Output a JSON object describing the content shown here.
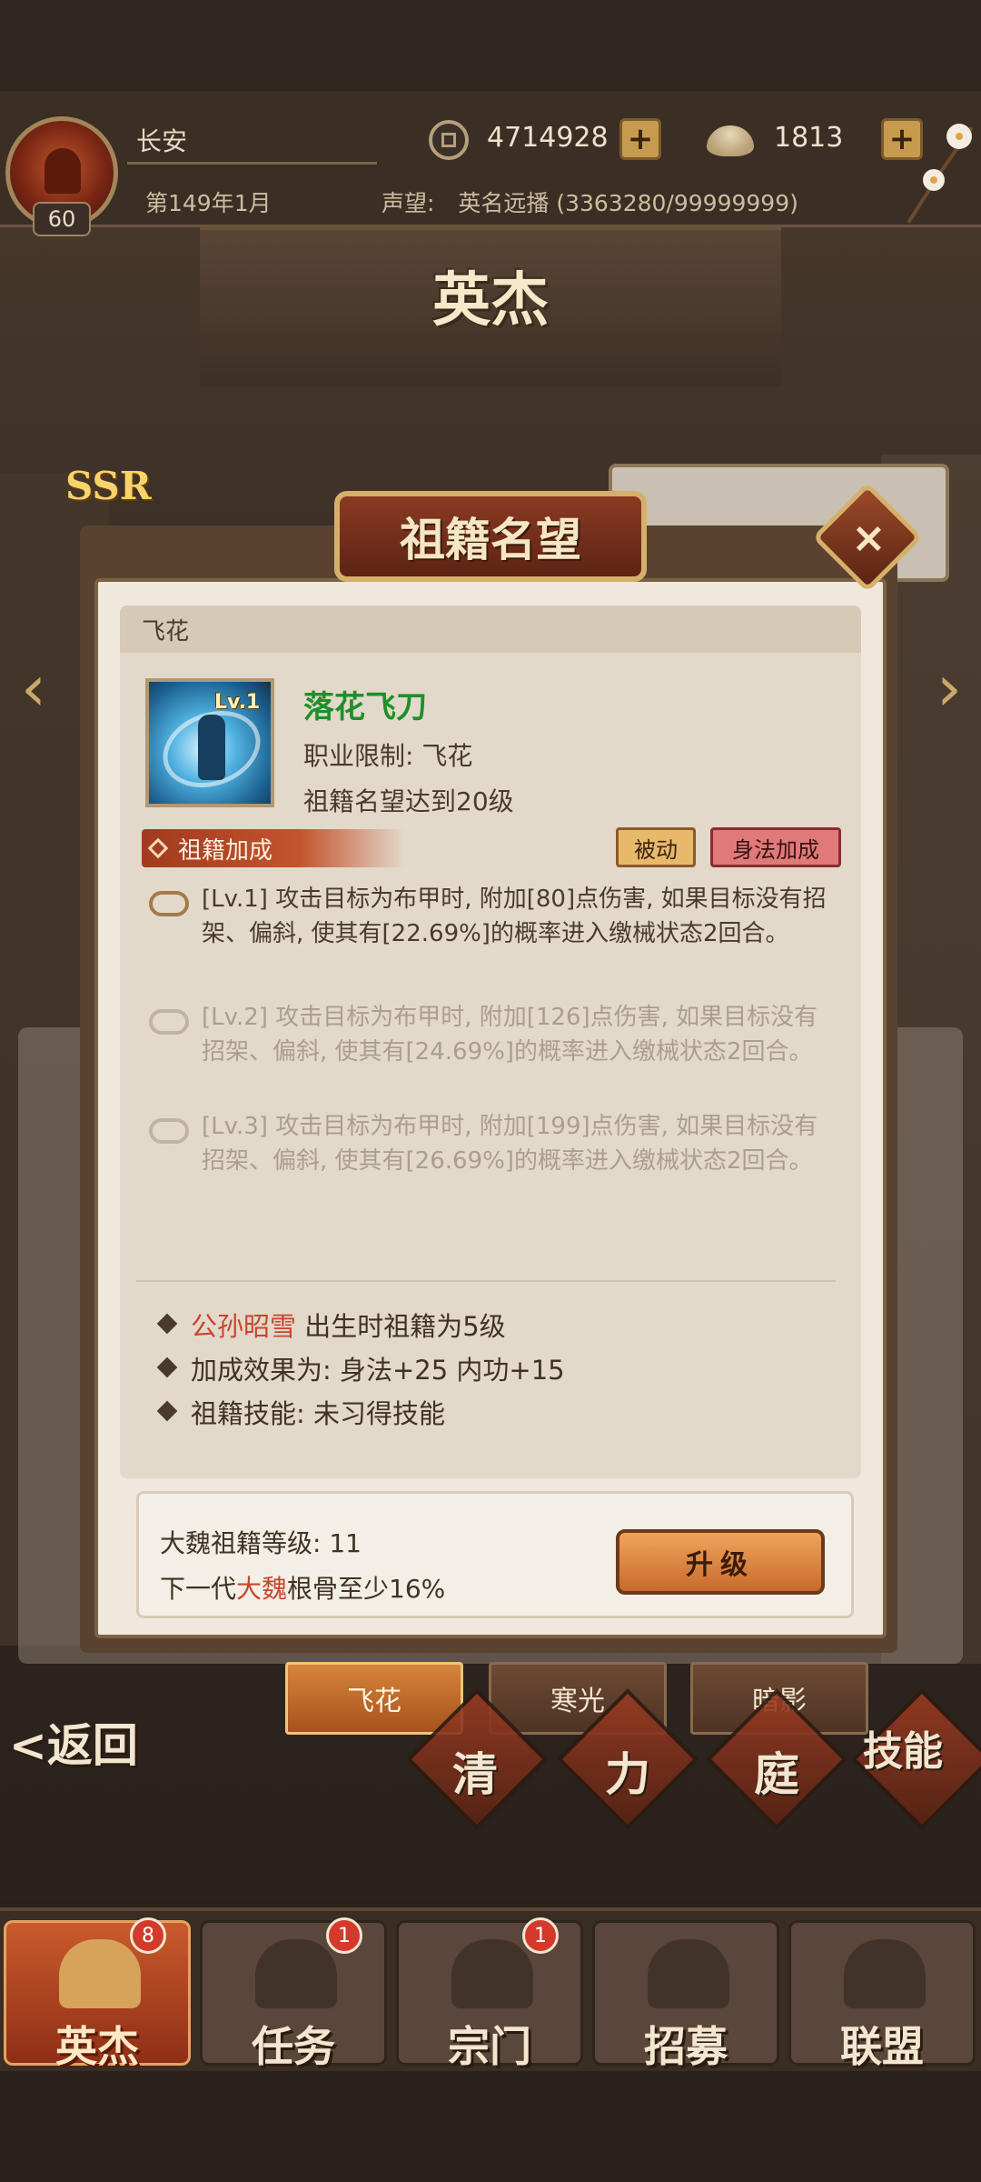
{
  "status_bar": {
    "city": "长安",
    "level": "60",
    "coins": "4714928",
    "ingots": "1813",
    "date": "第149年1月",
    "fame_label": "声望:",
    "fame_value": "英名远播 (3363280/99999999)",
    "plus_symbol": "+"
  },
  "background": {
    "page_title": "英杰",
    "rarity": "SSR"
  },
  "dialog": {
    "title": "祖籍名望",
    "close_symbol": "⨯",
    "card_header": "飞花",
    "skill": {
      "level_tag": "Lv.1",
      "name": "落花飞刀",
      "requirement_class": "职业限制: 飞花",
      "requirement_fame": "祖籍名望达到20级"
    },
    "section_label": "祖籍加成",
    "tag_passive": "被动",
    "tag_bonus": "身法加成",
    "effects": [
      {
        "text": "[Lv.1] 攻击目标为布甲时, 附加[80]点伤害, 如果目标没有招架、偏斜, 使其有[22.69%]的概率进入缴械状态2回合。",
        "active": true
      },
      {
        "text": "[Lv.2] 攻击目标为布甲时, 附加[126]点伤害, 如果目标没有招架、偏斜, 使其有[24.69%]的概率进入缴械状态2回合。",
        "active": false
      },
      {
        "text": "[Lv.3] 攻击目标为布甲时, 附加[199]点伤害, 如果目标没有招架、偏斜, 使其有[26.69%]的概率进入缴械状态2回合。",
        "active": false
      }
    ],
    "info": {
      "hero_name": "公孙昭雪",
      "hero_suffix": " 出生时祖籍为5级",
      "bonus_line": "加成效果为: 身法+25  内功+15",
      "skill_line": "祖籍技能: 未习得技能"
    },
    "bottom": {
      "national_level": "大魏祖籍等级: 11",
      "next_gen_prefix": "下一代",
      "next_gen_highlight": "大魏",
      "next_gen_suffix": "根骨至少16%",
      "upgrade_label": "升级"
    }
  },
  "class_tabs": [
    {
      "label": "飞花",
      "active": true
    },
    {
      "label": "寒光",
      "active": false
    },
    {
      "label": "暗影",
      "active": false
    }
  ],
  "lower_menu": {
    "back_label": "<返回",
    "items": [
      "清",
      "力",
      "庭",
      "技能"
    ]
  },
  "bottom_nav": [
    {
      "label": "英杰",
      "badge": "8",
      "active": true
    },
    {
      "label": "任务",
      "badge": "1",
      "active": false
    },
    {
      "label": "宗门",
      "badge": "1",
      "active": false
    },
    {
      "label": "招募",
      "badge": "",
      "active": false
    },
    {
      "label": "联盟",
      "badge": "",
      "active": false
    }
  ],
  "colors": {
    "skill_name": "#1f8f2a",
    "highlight_red": "#c8452c",
    "active_tab": "#d7843c"
  }
}
